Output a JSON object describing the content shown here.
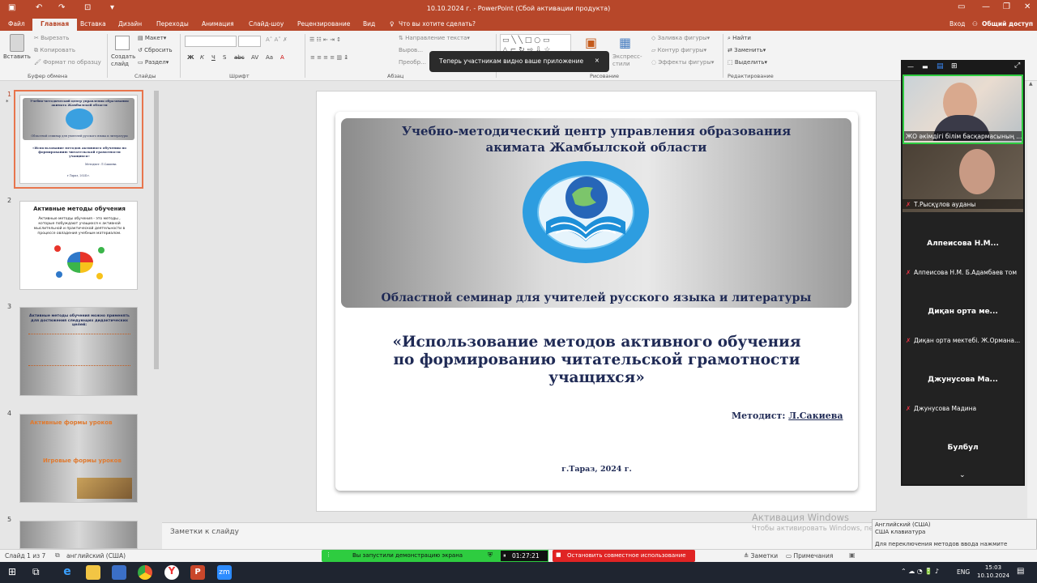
{
  "window": {
    "title": "10.10.2024 г. - PowerPoint (Сбой активации продукта)"
  },
  "ribbon_tabs": [
    "Файл",
    "Главная",
    "Вставка",
    "Дизайн",
    "Переходы",
    "Анимация",
    "Слайд-шоу",
    "Рецензирование",
    "Вид"
  ],
  "tell_me": "Что вы хотите сделать?",
  "account": {
    "login": "Вход",
    "share": "Общий доступ"
  },
  "ribbon": {
    "paste": "Вставить",
    "cut": "Вырезать",
    "copy": "Копировать",
    "format_painter": "Формат по образцу",
    "new_slide": "Создать слайд",
    "layout": "Макет",
    "reset": "Сбросить",
    "section": "Раздел",
    "text_direction": "Направление текста",
    "shape_fill": "Заливка фигуры",
    "shape_outline": "Контур фигуры",
    "shape_effects": "Эффекты фигуры",
    "quick_styles": "Экспресс-стили",
    "find": "Найти",
    "replace": "Заменить",
    "select": "Выделить",
    "groups": {
      "clipboard": "Буфер обмена",
      "slides": "Слайды",
      "font": "Шрифт",
      "paragraph": "Абзац",
      "drawing": "Рисование",
      "editing": "Редактирование"
    }
  },
  "toast": {
    "text": "Теперь участникам видно ваше приложение",
    "close": "×"
  },
  "thumbnails": [
    {
      "num": "1",
      "title": "Учебно-методический центр управления образования акимата Жамбылской области",
      "subtitle": "Областной семинар для учителей русского языка и литературы",
      "body": "«Использование методов активного обучения по формированию читательской грамотности учащихся»",
      "author": "Методист: Л.Сакиева",
      "footer": "г.Тараз, 2024 г."
    },
    {
      "num": "2",
      "title": "Активные методы обучения",
      "body": "Активные методы обучения - это методы , которые побуждают учащихся к активной мыслительной и практической деятельности в процессе овладения учебным материалом."
    },
    {
      "num": "3",
      "title": "Активные методы обучения можно применять для достижения следующих дидактических целей:"
    },
    {
      "num": "4",
      "title": "Активные формы уроков",
      "title2": "Игровые формы уроков"
    },
    {
      "num": "5"
    }
  ],
  "slide": {
    "org_line1": "Учебно-методический центр управления образования",
    "org_line2": "акимата Жамбылской области",
    "seminar": "Областной семинар для учителей русского языка и литературы",
    "title_line1": "«Использование методов активного обучения",
    "title_line2": "по формированию читательской грамотности",
    "title_line3": "учащихся»",
    "author_label": "Методист:",
    "author_name": "Л.Сакиева",
    "footer": "г.Тараз, 2024 г."
  },
  "notes_placeholder": "Заметки к слайду",
  "activation": {
    "title": "Активация Windows",
    "text": "Чтобы активировать Windows, перейдите в раздел \"Параметры\"."
  },
  "lang_popup": {
    "line1": "Английский (США)",
    "line2": "США клавиатура",
    "hint": "Для переключения методов ввода нажмите клавиши WINDOWS+ПРОБЕЛ."
  },
  "status": {
    "slide": "Слайд 1 из 7",
    "language": "английский (США)",
    "notes": "Заметки",
    "comments": "Примечания"
  },
  "share_bar": {
    "text": "Вы запустили демонстрацию экрана",
    "timer": "01:27:21",
    "stop": "Остановить совместное использование"
  },
  "zoom": {
    "participants": [
      {
        "name": "ЖО әкімдігі білім басқармасының ...",
        "video": true
      },
      {
        "name": "Т.Рысқұлов ауданы",
        "video": true
      },
      {
        "display": "Алпеисова Н.М...",
        "name": "Алпеисова Н.М. Б.Адамбаев том"
      },
      {
        "display": "Диқан орта ме...",
        "name": "Диқан орта мектебі. Ж.Ормана..."
      },
      {
        "display": "Джунусова Ма...",
        "name": "Джунусова Мадина"
      },
      {
        "display": "Булбул",
        "name": ""
      }
    ]
  },
  "taskbar": {
    "language": "ENG",
    "time": "15:03",
    "date": "10.10.2024"
  }
}
